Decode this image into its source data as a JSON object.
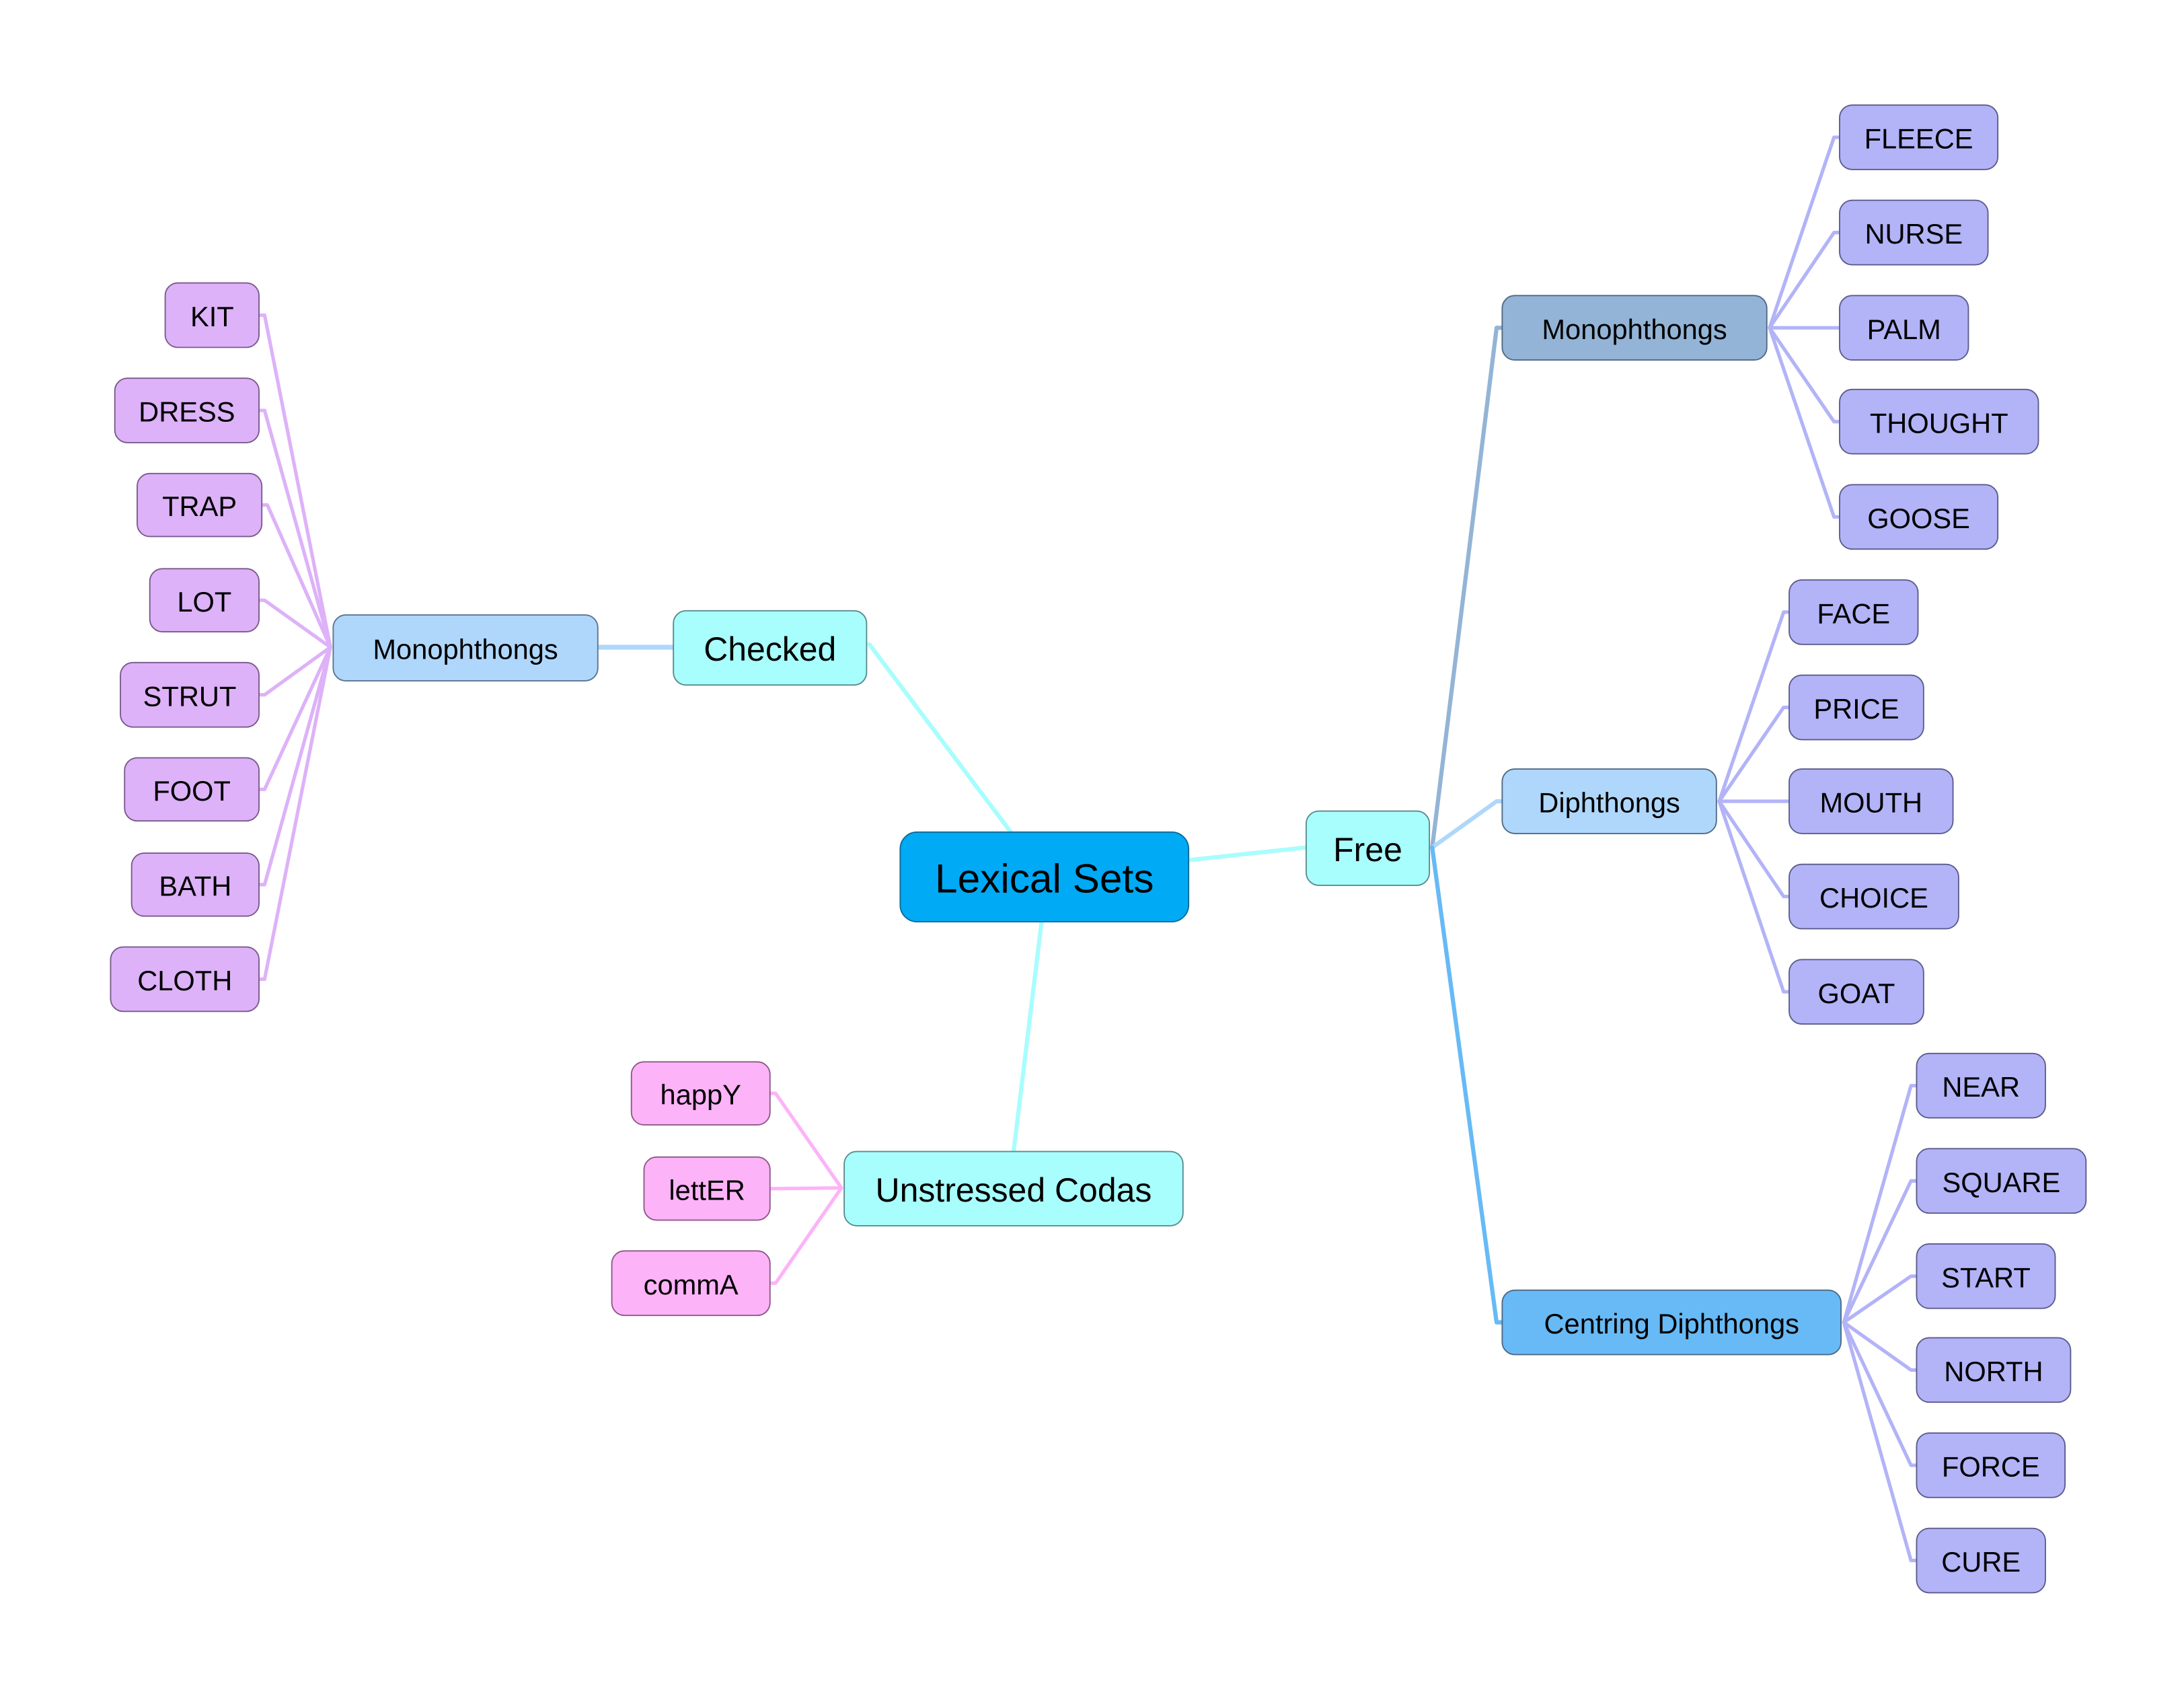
{
  "title": "Lexical Sets",
  "colors": {
    "background": "#ffffff",
    "root_fill": "#00aaf5",
    "root_text": "#ffffff",
    "branch_fill": "#a8fdfd",
    "checked_mono_fill": "#afd7fb",
    "free_mono_fill": "#93b4d6",
    "free_diph_fill": "#afd7fb",
    "centring_fill": "#67baf5",
    "checked_leaf_fill": "#ddb2f8",
    "free_leaf_fill": "#b3b3f8",
    "coda_leaf_fill": "#fdb3f8",
    "edge_root": "#a8fdfd",
    "edge_checked_mono": "#afd7fb",
    "edge_checked_leaf": "#ddb2f8",
    "edge_free_mono": "#93b4d6",
    "edge_free_diph": "#afd7fb",
    "edge_centring": "#67baf5",
    "edge_free_leaf": "#b3b3f8",
    "edge_coda_leaf": "#fdb3f8"
  },
  "root": {
    "label": "Lexical Sets"
  },
  "branches": {
    "checked": {
      "label": "Checked",
      "groups": [
        {
          "label": "Monophthongs",
          "items": [
            "KIT",
            "DRESS",
            "TRAP",
            "LOT",
            "STRUT",
            "FOOT",
            "BATH",
            "CLOTH"
          ]
        }
      ]
    },
    "free": {
      "label": "Free",
      "groups": [
        {
          "label": "Monophthongs",
          "items": [
            "FLEECE",
            "NURSE",
            "PALM",
            "THOUGHT",
            "GOOSE"
          ]
        },
        {
          "label": "Diphthongs",
          "items": [
            "FACE",
            "PRICE",
            "MOUTH",
            "CHOICE",
            "GOAT"
          ]
        },
        {
          "label": "Centring Diphthongs",
          "items": [
            "NEAR",
            "SQUARE",
            "START",
            "NORTH",
            "FORCE",
            "CURE"
          ]
        }
      ]
    },
    "unstressed": {
      "label": "Unstressed Codas",
      "items": [
        "happY",
        "lettER",
        "commA"
      ]
    }
  }
}
